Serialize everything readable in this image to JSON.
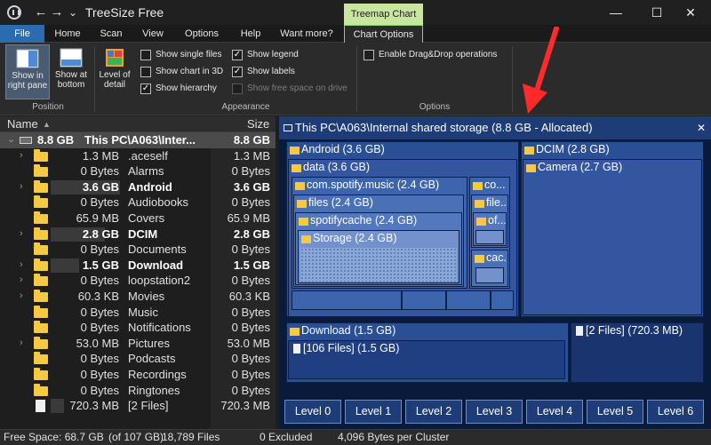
{
  "window": {
    "title": "TreeSize Free",
    "context_tab": "Treemap Chart",
    "back": "←",
    "forward": "→",
    "menu": "⌄",
    "minimize": "—",
    "maximize": "☐",
    "close": "✕"
  },
  "ribbon_tabs": [
    "File",
    "Home",
    "Scan",
    "View",
    "Options",
    "Help",
    "Want more?",
    "Chart Options"
  ],
  "ribbon": {
    "position": {
      "right_pane": "Show in right pane",
      "bottom": "Show at bottom",
      "label": "Position"
    },
    "level_of_detail": "Level of detail",
    "appearance": {
      "show_single_files": "Show single files",
      "show_chart_3d": "Show chart in 3D",
      "show_hierarchy": "Show hierarchy",
      "show_legend": "Show legend",
      "show_labels": "Show labels",
      "show_free_space": "Show free space on drive",
      "label": "Appearance"
    },
    "options": {
      "drag_drop": "Enable Drag&Drop operations",
      "label": "Options"
    },
    "checks": {
      "show_single_files": false,
      "show_chart_3d": false,
      "show_hierarchy": true,
      "show_legend": true,
      "show_labels": true,
      "show_free_space": false,
      "drag_drop": false
    },
    "checkmark": "✓"
  },
  "tree": {
    "header_name": "Name",
    "header_size": "Size",
    "sort_glyph": "▲",
    "root": {
      "size": "8.8 GB",
      "name": "This PC\\A063\\Inter...",
      "size2": "8.8 GB",
      "expander": "⌄"
    },
    "rows": [
      {
        "size": "1.3 MB",
        "name": ".aceself",
        "size2": "1.3 MB",
        "expander": "›",
        "bold": false,
        "bar": 0
      },
      {
        "size": "0 Bytes",
        "name": "Alarms",
        "size2": "0 Bytes",
        "expander": "",
        "bold": false,
        "bar": 0
      },
      {
        "size": "3.6 GB",
        "name": "Android",
        "size2": "3.6 GB",
        "expander": "›",
        "bold": true,
        "bar": 0.41
      },
      {
        "size": "0 Bytes",
        "name": "Audiobooks",
        "size2": "0 Bytes",
        "expander": "",
        "bold": false,
        "bar": 0
      },
      {
        "size": "65.9 MB",
        "name": "Covers",
        "size2": "65.9 MB",
        "expander": "",
        "bold": false,
        "bar": 0
      },
      {
        "size": "2.8 GB",
        "name": "DCIM",
        "size2": "2.8 GB",
        "expander": "›",
        "bold": true,
        "bar": 0.32
      },
      {
        "size": "0 Bytes",
        "name": "Documents",
        "size2": "0 Bytes",
        "expander": "",
        "bold": false,
        "bar": 0
      },
      {
        "size": "1.5 GB",
        "name": "Download",
        "size2": "1.5 GB",
        "expander": "›",
        "bold": true,
        "bar": 0.17
      },
      {
        "size": "0 Bytes",
        "name": "loopstation2",
        "size2": "0 Bytes",
        "expander": "›",
        "bold": false,
        "bar": 0
      },
      {
        "size": "60.3 KB",
        "name": "Movies",
        "size2": "60.3 KB",
        "expander": "›",
        "bold": false,
        "bar": 0
      },
      {
        "size": "0 Bytes",
        "name": "Music",
        "size2": "0 Bytes",
        "expander": "",
        "bold": false,
        "bar": 0
      },
      {
        "size": "0 Bytes",
        "name": "Notifications",
        "size2": "0 Bytes",
        "expander": "",
        "bold": false,
        "bar": 0
      },
      {
        "size": "53.0 MB",
        "name": "Pictures",
        "size2": "53.0 MB",
        "expander": "›",
        "bold": false,
        "bar": 0
      },
      {
        "size": "0 Bytes",
        "name": "Podcasts",
        "size2": "0 Bytes",
        "expander": "",
        "bold": false,
        "bar": 0
      },
      {
        "size": "0 Bytes",
        "name": "Recordings",
        "size2": "0 Bytes",
        "expander": "",
        "bold": false,
        "bar": 0
      },
      {
        "size": "0 Bytes",
        "name": "Ringtones",
        "size2": "0 Bytes",
        "expander": "",
        "bold": false,
        "bar": 0
      },
      {
        "size": "720.3 MB",
        "name": "[2 Files]",
        "size2": "720.3 MB",
        "expander": "",
        "bold": false,
        "bar": 0.08,
        "file": true
      }
    ]
  },
  "treemap": {
    "title": "This PC\\A063\\Internal shared storage (8.8 GB - Allocated)",
    "close": "✕",
    "android": "Android (3.6 GB)",
    "data": "data (3.6 GB)",
    "spotify": "com.spotify.music (2.4 GB)",
    "files": "files (2.4 GB)",
    "spotifycache": "spotifycache (2.4 GB)",
    "storage": "Storage (2.4 GB)",
    "co": "co...",
    "file": "file...",
    "of": "of...",
    "cac": "cac...",
    "dcim": "DCIM (2.8 GB)",
    "camera": "Camera (2.7 GB)",
    "download": "Download (1.5 GB)",
    "download_files": "[106 Files] (1.5 GB)",
    "root_files": "[2 Files] (720.3 MB)",
    "levels": [
      "Level 0",
      "Level 1",
      "Level 2",
      "Level 3",
      "Level 4",
      "Level 5",
      "Level 6"
    ]
  },
  "status": {
    "free_space": "Free Space: 68.7 GB",
    "of_total": "(of 107 GB)",
    "files": "18,789 Files",
    "excluded": "0 Excluded",
    "cluster": "4,096 Bytes per Cluster"
  },
  "colors": {
    "treemap_title": "#1e3c78",
    "treemap_level1": "#2a4f95",
    "treemap_level2": "#3d65ad",
    "treemap_level3": "#5478be",
    "treemap_level4": "#7391cc",
    "context_tab": "#c8e6a0",
    "file_tab": "#2b6cb0",
    "annotation_arrow": "#ff2a2a"
  }
}
